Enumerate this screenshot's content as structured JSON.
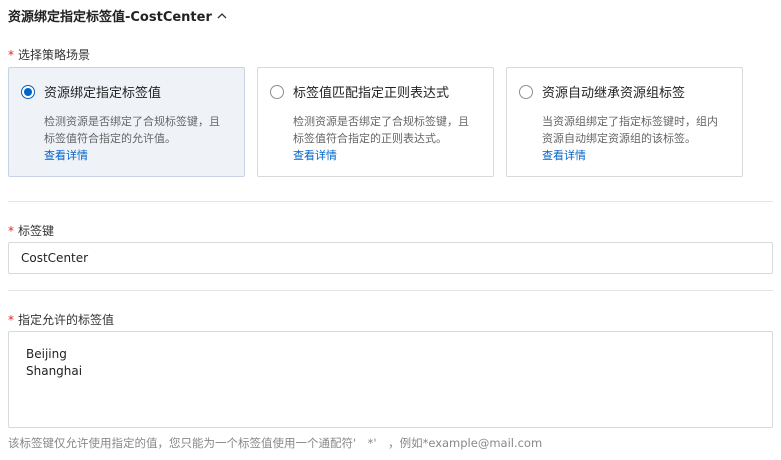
{
  "header": {
    "title": "资源绑定指定标签值-CostCenter",
    "chevron_icon": "chevron-up-icon"
  },
  "strategy": {
    "required_mark": "*",
    "label": "选择策略场景",
    "options": [
      {
        "title": "资源绑定指定标签值",
        "desc": "检测资源是否绑定了合规标签键，且标签值符合指定的允许值。",
        "link": "查看详情",
        "selected": true
      },
      {
        "title": "标签值匹配指定正则表达式",
        "desc": "检测资源是否绑定了合规标签键，且标签值符合指定的正则表达式。",
        "link": "查看详情",
        "selected": false
      },
      {
        "title": "资源自动继承资源组标签",
        "desc": "当资源组绑定了指定标签键时，组内资源自动绑定资源组的该标签。",
        "link": "查看详情",
        "selected": false
      }
    ]
  },
  "tag_key": {
    "required_mark": "*",
    "label": "标签键",
    "value": "CostCenter"
  },
  "allowed_values": {
    "required_mark": "*",
    "label": "指定允许的标签值",
    "value": "Beijing\nShanghai",
    "help": "该标签键仅允许使用指定的值，您只能为一个标签值使用一个通配符'　*'　，例如*example@mail.com"
  },
  "colors": {
    "accent": "#0064c8",
    "required": "#e0281f",
    "selected_card_bg": "#eff3f8"
  }
}
